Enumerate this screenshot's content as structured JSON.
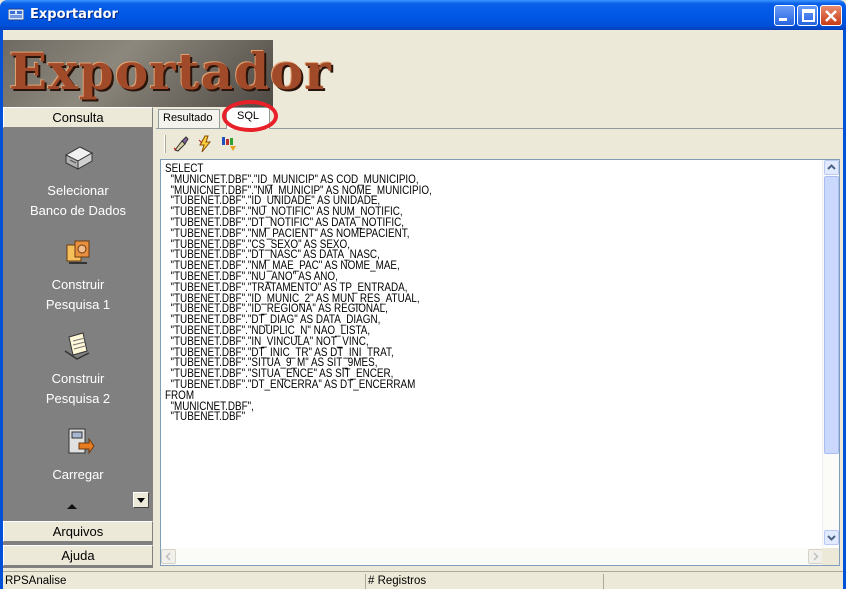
{
  "window": {
    "title": "Exportardor",
    "colors": {
      "titlebar": "#0058e6",
      "close": "#c83b14"
    }
  },
  "banner": {
    "logo_text": "Exportador",
    "logo_color": "#a14a2a"
  },
  "sidebar": {
    "header": "Consulta",
    "items": [
      {
        "label1": "Selecionar",
        "label2": "Banco de Dados",
        "icon": "database-icon"
      },
      {
        "label1": "Construir",
        "label2": "Pesquisa 1",
        "icon": "build-query-icon"
      },
      {
        "label1": "Construir",
        "label2": "Pesquisa 2",
        "icon": "build-query-2-icon"
      },
      {
        "label1": "Carregar",
        "label2": "",
        "icon": "load-icon"
      }
    ],
    "sections": [
      "Arquivos",
      "Ajuda"
    ]
  },
  "tabs": [
    {
      "label": "Resultado"
    },
    {
      "label": "SQL"
    }
  ],
  "toolbar": {
    "icons": [
      "clear-icon",
      "execute-icon",
      "build-icon"
    ]
  },
  "sql_text": "SELECT\n  \"MUNICNET.DBF\".\"ID_MUNICIP\" AS COD_MUNICIPIO,\n  \"MUNICNET.DBF\".\"NM_MUNICIP\" AS NOME_MUNICIPIO,\n  \"TUBENET.DBF\".\"ID_UNIDADE\" AS UNIDADE,\n  \"TUBENET.DBF\".\"NU_NOTIFIC\" AS NUM_NOTIFIC,\n  \"TUBENET.DBF\".\"DT_NOTIFIC\" AS DATA_NOTIFIC,\n  \"TUBENET.DBF\".\"NM_PACIENT\" AS NOMEPACIENT,\n  \"TUBENET.DBF\".\"CS_SEXO\" AS SEXO,\n  \"TUBENET.DBF\".\"DT_NASC\" AS DATA_NASC,\n  \"TUBENET.DBF\".\"NM_MAE_PAC\" AS NOME_MAE,\n  \"TUBENET.DBF\".\"NU_ANO\" AS ANO,\n  \"TUBENET.DBF\".\"TRATAMENTO\" AS TP_ENTRADA,\n  \"TUBENET.DBF\".\"ID_MUNIC_2\" AS MUN_RES_ATUAL,\n  \"TUBENET.DBF\".\"ID_REGIONA\" AS REGIONAL,\n  \"TUBENET.DBF\".\"DT_DIAG\" AS DATA_DIAGN,\n  \"TUBENET.DBF\".\"NDUPLIC_N\" NAO_LISTA,\n  \"TUBENET.DBF\".\"IN_VINCULA\" NOT_VINC,\n  \"TUBENET.DBF\".\"DT_INIC_TR\" AS DT_INI_TRAT,\n  \"TUBENET.DBF\".\"SITUA_9_M\" AS SIT_9MES,\n  \"TUBENET.DBF\".\"SITUA_ENCE\" AS SIT_ENCER,\n  \"TUBENET.DBF\".\"DT_ENCERRA\" AS DT_ENCERRAM\nFROM\n  \"MUNICNET.DBF\",\n  \"TUBENET.DBF\"",
  "status": {
    "left": "RPSAnalise",
    "middle": "# Registros",
    "right": ""
  },
  "highlight": {
    "color": "#e8202a"
  }
}
